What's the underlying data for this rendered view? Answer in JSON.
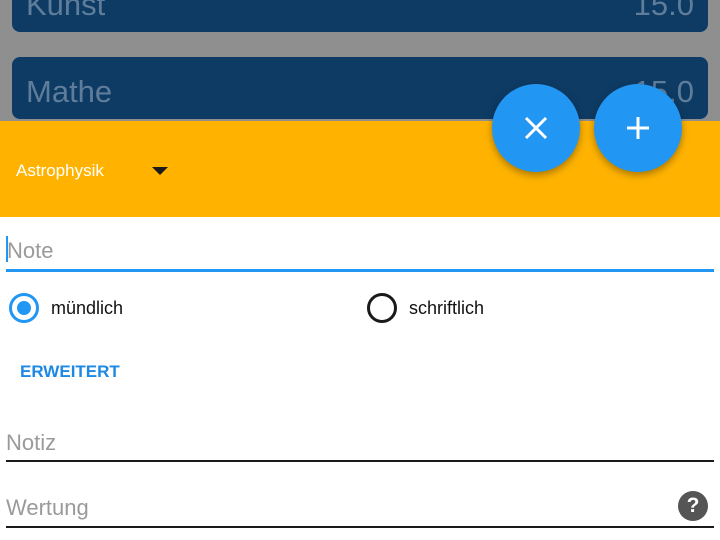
{
  "background_list": {
    "items": [
      {
        "name": "Kunst",
        "grade": "15.0"
      },
      {
        "name": "Mathe",
        "grade": "15.0"
      }
    ]
  },
  "header": {
    "subject": "Astrophysik",
    "dropdown_icon": "caret-down-icon"
  },
  "fabs": {
    "close_icon": "close-icon",
    "add_icon": "plus-icon"
  },
  "form": {
    "note_placeholder": "Note",
    "radio_options": [
      {
        "label": "mündlich",
        "checked": true
      },
      {
        "label": "schriftlich",
        "checked": false
      }
    ],
    "advanced_label": "ERWEITERT",
    "notiz_placeholder": "Notiz",
    "wertung_placeholder": "Wertung",
    "help_glyph": "?"
  },
  "colors": {
    "header": "#ffb300",
    "accent": "#2196f3",
    "card": "#0e3b64"
  }
}
